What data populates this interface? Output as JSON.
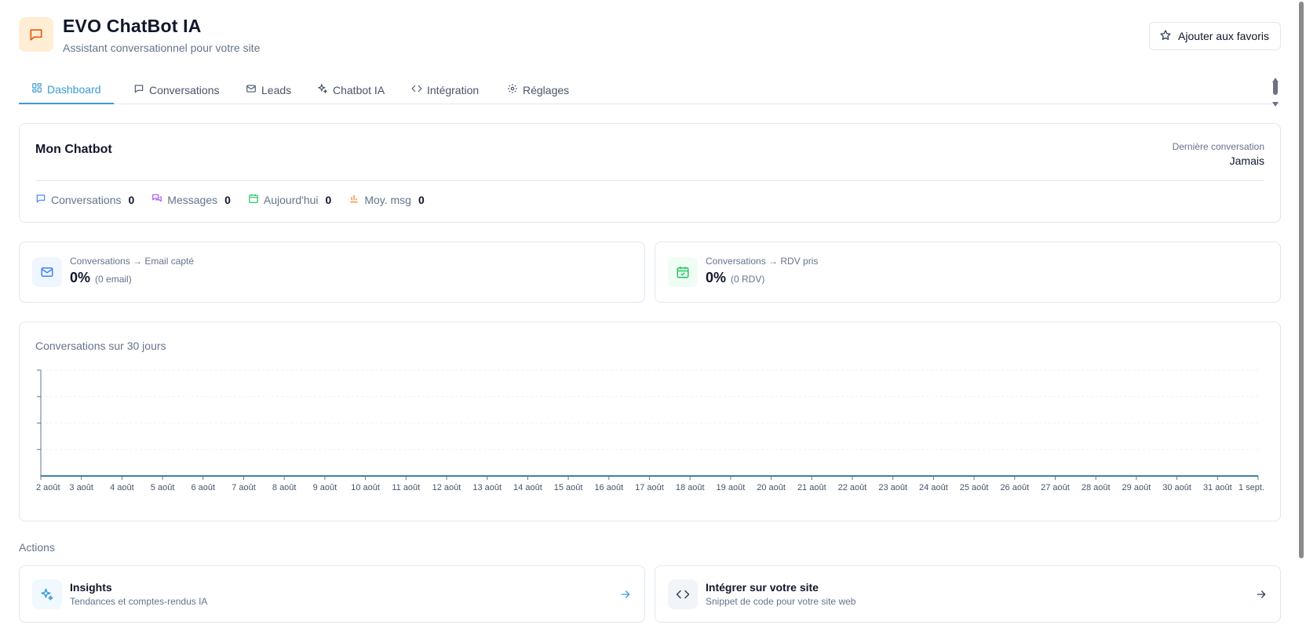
{
  "app": {
    "title": "EVO ChatBot IA",
    "subtitle": "Assistant conversationnel pour votre site",
    "favorite_label": "Ajouter aux favoris"
  },
  "tabs": [
    {
      "label": "Dashboard",
      "icon": "dashboard-icon",
      "active": true
    },
    {
      "label": "Conversations",
      "icon": "chat-icon",
      "active": false
    },
    {
      "label": "Leads",
      "icon": "mail-icon",
      "active": false
    },
    {
      "label": "Chatbot IA",
      "icon": "sparkles-icon",
      "active": false
    },
    {
      "label": "Intégration",
      "icon": "code-icon",
      "active": false
    },
    {
      "label": "Réglages",
      "icon": "gear-icon",
      "active": false
    }
  ],
  "bot": {
    "name": "Mon Chatbot",
    "last_conversation_label": "Dernière conversation",
    "last_conversation_value": "Jamais",
    "stats": [
      {
        "label": "Conversations",
        "value": "0",
        "icon": "chat-icon",
        "color": "#3b82f6"
      },
      {
        "label": "Messages",
        "value": "0",
        "icon": "messages-icon",
        "color": "#a855f7"
      },
      {
        "label": "Aujourd'hui",
        "value": "0",
        "icon": "calendar-icon",
        "color": "#22c55e"
      },
      {
        "label": "Moy. msg",
        "value": "0",
        "icon": "bar-chart-icon",
        "color": "#f97316"
      }
    ]
  },
  "kpis": [
    {
      "label": "Conversations → Email capté",
      "value": "0%",
      "sub": "(0 email)",
      "icon": "mail-icon",
      "color": "#3b82f6",
      "bg": "#eff6ff"
    },
    {
      "label": "Conversations → RDV pris",
      "value": "0%",
      "sub": "(0 RDV)",
      "icon": "calendar-check-icon",
      "color": "#22c55e",
      "bg": "#f0fdf4"
    }
  ],
  "chart_data": {
    "type": "line",
    "title": "Conversations sur 30 jours",
    "xlabel": "",
    "ylabel": "",
    "categories": [
      "2 août",
      "3 août",
      "4 août",
      "5 août",
      "6 août",
      "7 août",
      "8 août",
      "9 août",
      "10 août",
      "11 août",
      "12 août",
      "13 août",
      "14 août",
      "15 août",
      "16 août",
      "17 août",
      "18 août",
      "19 août",
      "20 août",
      "21 août",
      "22 août",
      "23 août",
      "24 août",
      "25 août",
      "26 août",
      "27 août",
      "28 août",
      "29 août",
      "30 août",
      "31 août",
      "1 sept."
    ],
    "values": [
      0,
      0,
      0,
      0,
      0,
      0,
      0,
      0,
      0,
      0,
      0,
      0,
      0,
      0,
      0,
      0,
      0,
      0,
      0,
      0,
      0,
      0,
      0,
      0,
      0,
      0,
      0,
      0,
      0,
      0,
      0
    ],
    "ylim": [
      0,
      4
    ],
    "grid": true,
    "line_color": "#3b82a6"
  },
  "actions": {
    "title": "Actions",
    "items": [
      {
        "title": "Insights",
        "desc": "Tendances et comptes-rendus IA",
        "icon": "sparkles-icon",
        "color": "#3b9bd6",
        "bg": "#f0f9ff"
      },
      {
        "title": "Intégrer sur votre site",
        "desc": "Snippet de code pour votre site web",
        "icon": "code-icon",
        "color": "#334155",
        "bg": "#f1f5f9"
      }
    ]
  }
}
